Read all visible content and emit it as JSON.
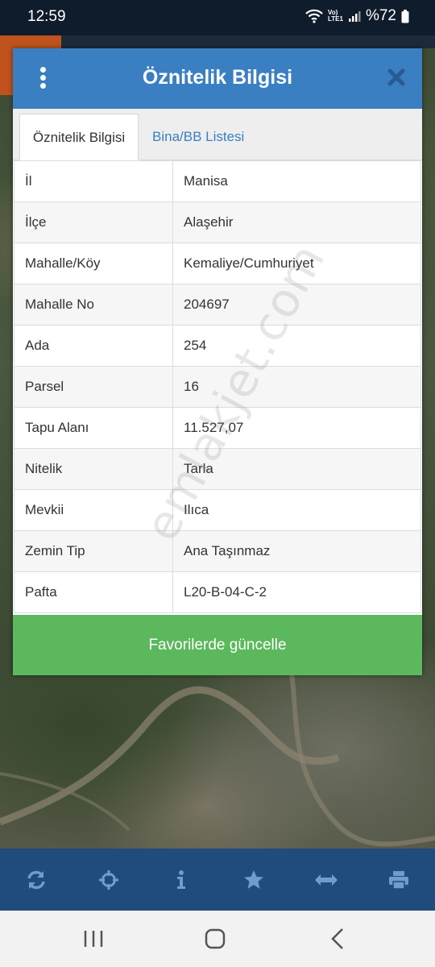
{
  "status_bar": {
    "time": "12:59",
    "battery": "%72",
    "net_line1": "Vo)",
    "net_line2": "LTE1"
  },
  "dialog": {
    "title": "Öznitelik Bilgisi",
    "tabs": [
      {
        "label": "Öznitelik Bilgisi",
        "active": true
      },
      {
        "label": "Bina/BB Listesi",
        "active": false
      }
    ],
    "rows": [
      {
        "key": "İl",
        "value": "Manisa"
      },
      {
        "key": "İlçe",
        "value": "Alaşehir"
      },
      {
        "key": "Mahalle/Köy",
        "value": "Kemaliye/Cumhuriyet"
      },
      {
        "key": "Mahalle No",
        "value": "204697"
      },
      {
        "key": "Ada",
        "value": "254"
      },
      {
        "key": "Parsel",
        "value": "16"
      },
      {
        "key": "Tapu Alanı",
        "value": "11.527,07"
      },
      {
        "key": "Nitelik",
        "value": "Tarla"
      },
      {
        "key": "Mevkii",
        "value": "Ilıca"
      },
      {
        "key": "Zemin Tip",
        "value": "Ana Taşınmaz"
      },
      {
        "key": "Pafta",
        "value": "L20-B-04-C-2"
      }
    ],
    "favorite_button": "Favorilerde güncelle"
  },
  "watermark": "emlakjet.com",
  "toolbar": {
    "icons": [
      "refresh-icon",
      "crosshair-icon",
      "info-icon",
      "star-icon",
      "measure-icon",
      "print-icon"
    ]
  },
  "navbar": {
    "icons": [
      "recent-apps-icon",
      "home-icon",
      "back-icon"
    ]
  },
  "colors": {
    "header": "#3a7fc2",
    "button": "#5cb85c",
    "toolbar": "#1f4b7d",
    "toolbar_icon": "#6e9ccc"
  }
}
